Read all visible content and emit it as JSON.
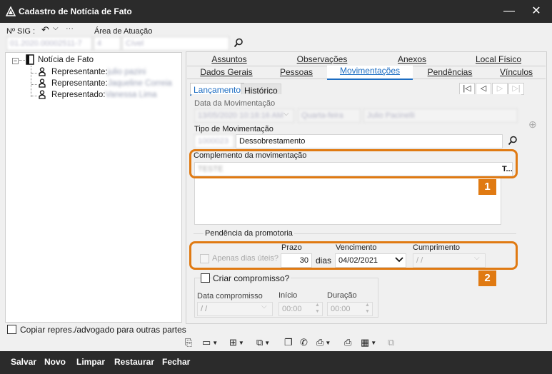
{
  "window": {
    "title": "Cadastro de Notícia de Fato"
  },
  "header": {
    "nsig_label": "Nº SIG :",
    "nsig_value": "01.2020.00002511-7",
    "area_label": "Área de Atuação",
    "area_code": "4",
    "area_value": "Cível"
  },
  "tree": {
    "root": "Notícia de Fato",
    "items": [
      {
        "label": "Representante:",
        "value": "julio pazini"
      },
      {
        "label": "Representante:",
        "value": "Jaqueline Correia"
      },
      {
        "label": "Representado:",
        "value": "Vanessa Lima"
      }
    ]
  },
  "copy_checkbox_label": "Copiar repres./advogado para outras partes",
  "tabs_row1": [
    "Assuntos",
    "Observações",
    "Anexos",
    "Local Físico"
  ],
  "tabs_row2": [
    "Dados Gerais",
    "Pessoas",
    "Movimentações",
    "Pendências",
    "Vínculos"
  ],
  "active_tab": "Movimentações",
  "subtabs": [
    "Lançamento",
    "Histórico"
  ],
  "nav_buttons": [
    "|◁",
    "◁",
    "▷",
    "▷|"
  ],
  "form": {
    "data_label": "Data da Movimentação",
    "data_value": "13/05/2020 10:18:16 AM",
    "weekday_value": "Quarta-feira",
    "user_value": "Julio Pacinelli",
    "tipo_label": "Tipo de Movimentação",
    "tipo_code": "1000023",
    "tipo_value": "Dessobrestamento",
    "complemento_label": "Complemento da movimentação",
    "complemento_value": "TESTE",
    "ellipsis": "T...",
    "pendencia_group": "Pendência da promotoria",
    "apenas_dias_label": "Apenas dias úteis?",
    "prazo_label": "Prazo",
    "prazo_value": "30",
    "dias_label": "dias",
    "vencimento_label": "Vencimento",
    "vencimento_value": "04/02/2021",
    "cumprimento_label": "Cumprimento",
    "cumprimento_value": "/ /",
    "criar_label": "Criar compromisso?",
    "data_comp_label": "Data compromisso",
    "data_comp_value": "/ /",
    "inicio_label": "Início",
    "inicio_value": "00:00",
    "duracao_label": "Duração",
    "duracao_value": "00:00"
  },
  "badges": [
    "1",
    "2"
  ],
  "bottom": {
    "buttons": [
      "Salvar",
      "Novo",
      "Limpar",
      "Restaurar",
      "Fechar"
    ]
  },
  "colors": {
    "accent": "#1b6cc2",
    "highlight": "#e07a12",
    "titlebar": "#2b2b2b"
  }
}
